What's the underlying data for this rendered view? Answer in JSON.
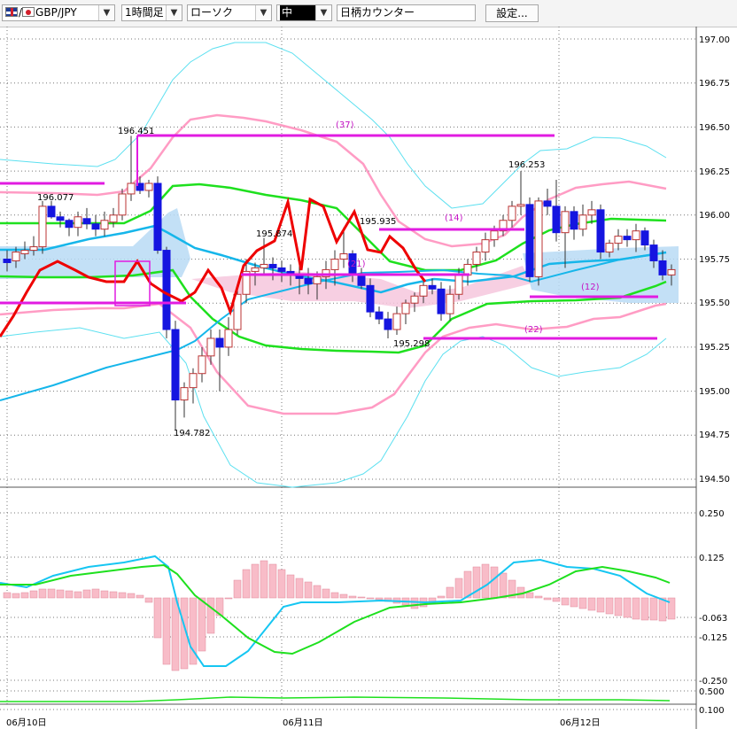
{
  "toolbar": {
    "pair": "GBP/JPY",
    "timeframe": "1時間足",
    "chart_type": "ローソク",
    "size": "中",
    "counter": "日柄カウンター",
    "settings": "設定..."
  },
  "chart_data": [
    {
      "type": "candlestick",
      "title": "",
      "x": [
        "06月10日",
        "06月11日",
        "06月12日"
      ],
      "price_ticks": [
        "197.00",
        "196.75",
        "196.50",
        "196.25",
        "196.00",
        "195.75",
        "195.50",
        "195.25",
        "195.00",
        "194.75",
        "194.50"
      ],
      "ylim": [
        194.4,
        197.05
      ],
      "grid": true,
      "legend": "none",
      "annotations": {
        "high_labels": [
          "196.451",
          "196.077",
          "195.874",
          "195.935",
          "196.253"
        ],
        "low_labels": [
          "194.782",
          "195.298"
        ],
        "counts": [
          "(37)",
          "(14)",
          "(21)",
          "(12)",
          "(22)"
        ]
      },
      "colors": {
        "bull": "#ffffff",
        "bear": "#1515e0",
        "bollinger_outer": "#5ce0f0",
        "bollinger_inner": "#ff9cc4",
        "mid_band": "#1ee01e",
        "moving_average": "#16b6ea",
        "counter_line": "#ee0000",
        "level_line": "#e11be1",
        "cloud_blue": "#b9dbf5",
        "cloud_pink": "#f6c7dd"
      }
    },
    {
      "type": "bar",
      "title": "",
      "y_ticks": [
        "0.250",
        "0.125",
        "-0.063",
        "-0.125",
        "-0.250",
        "0.500",
        "0.100"
      ],
      "grid": true,
      "legend": "none",
      "colors": {
        "histogram": "#f8bcc8",
        "macd": "#16c6f2",
        "signal": "#1ee01e"
      }
    }
  ]
}
